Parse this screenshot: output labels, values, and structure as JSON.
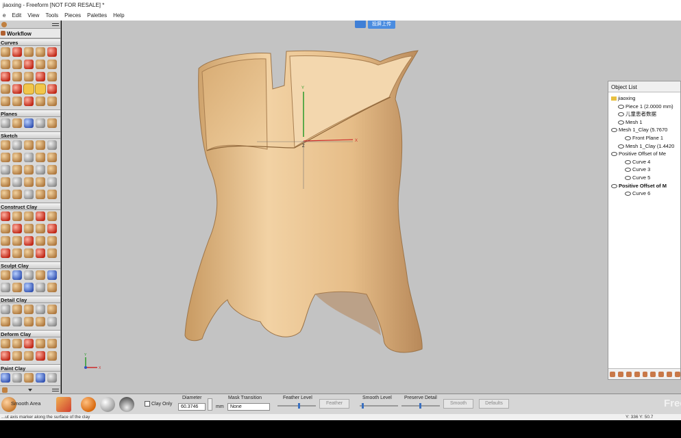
{
  "window": {
    "title": "jiaoxing - Freeform [NOT FOR RESALE] *"
  },
  "menu": [
    "e",
    "Edit",
    "View",
    "Tools",
    "Pieces",
    "Palettes",
    "Help"
  ],
  "overlay_badge": "投屏上传",
  "palette": {
    "workflow": "Workflow",
    "sections": [
      {
        "label": "Curves",
        "rows": 5
      },
      {
        "label": "Planes",
        "rows": 1
      },
      {
        "label": "Sketch",
        "rows": 5
      },
      {
        "label": "Construct Clay",
        "rows": 4
      },
      {
        "label": "Sculpt Clay",
        "rows": 2
      },
      {
        "label": "Detail Clay",
        "rows": 2
      },
      {
        "label": "Deform Clay",
        "rows": 2
      },
      {
        "label": "Paint Clay",
        "rows": 1
      }
    ]
  },
  "viewport": {
    "axis_y": "Y",
    "axis_z": "Z",
    "axis_x": "X",
    "mini_y": "Y",
    "mini_x": "X",
    "clay_color": "#e8c291"
  },
  "object_list": {
    "title": "Object List",
    "items": [
      {
        "label": "jiaoxing",
        "indent": 0,
        "kind": "folder"
      },
      {
        "label": "Piece 1 (2.0000 mm)",
        "indent": 1,
        "kind": "eye"
      },
      {
        "label": "儿童患者数据",
        "indent": 1,
        "kind": "eye"
      },
      {
        "label": "Mesh 1",
        "indent": 1,
        "kind": "eye"
      },
      {
        "label": "Mesh 1_Clay (5.7670",
        "indent": 0,
        "kind": "eye"
      },
      {
        "label": "Front Plane 1",
        "indent": 2,
        "kind": "eye"
      },
      {
        "label": "Mesh 1_Clay (1.4420",
        "indent": 1,
        "kind": "eye"
      },
      {
        "label": "Positive Offset of Me",
        "indent": 0,
        "kind": "eye"
      },
      {
        "label": "Curve 4",
        "indent": 2,
        "kind": "eye"
      },
      {
        "label": "Curve 3",
        "indent": 2,
        "kind": "eye"
      },
      {
        "label": "Curve 5",
        "indent": 2,
        "kind": "eye"
      },
      {
        "label": "Positive Offset of M",
        "indent": 0,
        "kind": "eye",
        "bold": true
      },
      {
        "label": "Curve 6",
        "indent": 2,
        "kind": "eye"
      }
    ]
  },
  "bottom": {
    "tool_name": "Smooth Area",
    "clay_only": "Clay Only",
    "diameter_label": "Diameter",
    "diameter_value": "60.3746",
    "diameter_unit": "mm",
    "mask_label": "Mask Transition",
    "mask_value": "None",
    "feather_label": "Feather Level",
    "feather_btn": "Feather",
    "smooth_label": "Smooth Level",
    "preserve_label": "Preserve Detail",
    "smooth_btn": "Smooth",
    "defaults_btn": "Defaults",
    "watermark": "Free"
  },
  "status": {
    "left": "...ut axis marker along the surface of the clay",
    "right": "Y: 336  Y: 50.7"
  }
}
